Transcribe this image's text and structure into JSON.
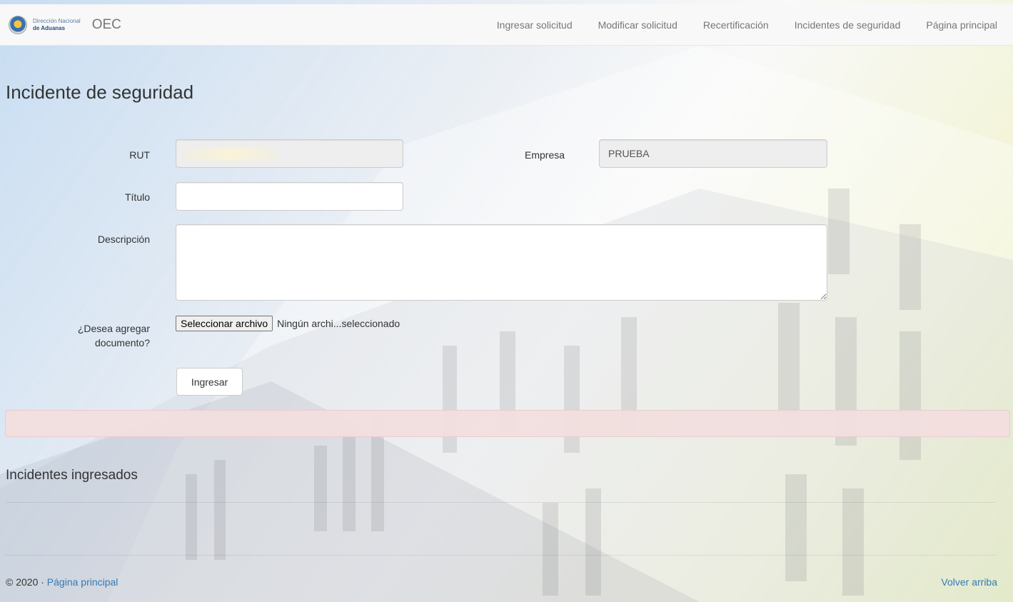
{
  "navbar": {
    "logo_line1": "Dirección Nacional",
    "logo_line2": "de Aduanas",
    "brand": "OEC",
    "links": [
      "Ingresar solicitud",
      "Modificar solicitud",
      "Recertificación",
      "Incidentes de seguridad",
      "Página principal"
    ]
  },
  "page": {
    "title": "Incidente de seguridad"
  },
  "form": {
    "rut_label": "RUT",
    "rut_value": "",
    "empresa_label": "Empresa",
    "empresa_value": "PRUEBA",
    "titulo_label": "Título",
    "titulo_value": "",
    "descripcion_label": "Descripción",
    "descripcion_value": "",
    "documento_label_line1": "¿Desea agregar",
    "documento_label_line2": "documento?",
    "file_button": "Seleccionar archivo",
    "file_status": "Ningún archi...seleccionado",
    "submit": "Ingresar"
  },
  "incidents": {
    "title": "Incidentes ingresados"
  },
  "footer": {
    "copyright": "© 2020 · ",
    "home_link": "Página principal",
    "back_to_top": "Volver arriba"
  }
}
